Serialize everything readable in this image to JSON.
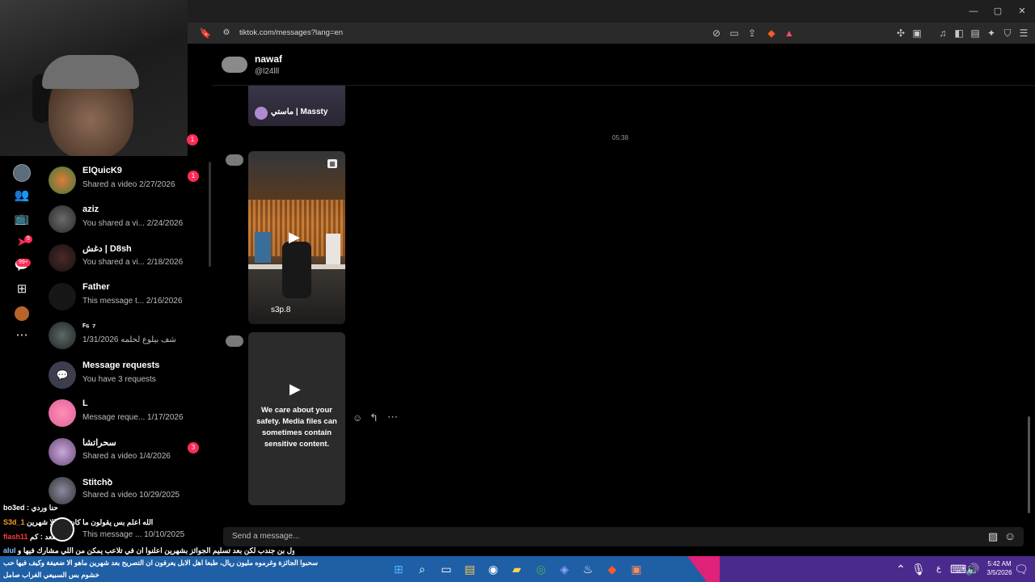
{
  "browser": {
    "url": "tiktok.com/messages?lang=en"
  },
  "rail": {
    "badge_activity": "5",
    "badge_inbox": "99+"
  },
  "conversations": [
    {
      "name": "ElQuicK9",
      "preview": "Shared a video",
      "date": "2/27/2026",
      "unread": "1"
    },
    {
      "name": "aziz",
      "preview": "You shared a vi...",
      "date": "2/24/2026",
      "unread": ""
    },
    {
      "name": "دغش | D8sh",
      "preview": "You shared a vi...",
      "date": "2/18/2026",
      "unread": ""
    },
    {
      "name": "Father",
      "preview": "This message t...",
      "date": "2/16/2026",
      "unread": ""
    },
    {
      "name": "ꟳ⁶ ⁷",
      "preview": "شف بيلوع لحلمه",
      "date": "1/31/2026",
      "unread": ""
    },
    {
      "name": "Message requests",
      "preview": "You have 3 requests",
      "date": "",
      "unread": ""
    },
    {
      "name": "L",
      "preview": "Message reque...",
      "date": "1/17/2026",
      "unread": ""
    },
    {
      "name": "سحراتشا",
      "preview": "Shared a video",
      "date": "1/4/2026",
      "unread": "3"
    },
    {
      "name": "Stitchꝺ",
      "preview": "Shared a video",
      "date": "10/29/2025",
      "unread": ""
    },
    {
      "name": "",
      "preview": "This message ...",
      "date": "10/10/2025",
      "unread": ""
    }
  ],
  "top_unread_badge": "1",
  "chat": {
    "name": "nawaf",
    "handle": "@l24lll",
    "timestamp": "05:38",
    "card1_label": "ماستي | Massty",
    "card2_label": "s3p.8",
    "safety_text": "We care about your safety. Media files can sometimes contain sensitive content.",
    "input_placeholder": "Send a message..."
  },
  "stream_chat": [
    {
      "user": "bo3ed",
      "text": "حنا وردي",
      "color": "#ffffff"
    },
    {
      "user": "S3d_1",
      "text": "الله اعلم بس يقولون ما كان فيه الا شهرين",
      "color": "#f0a030"
    },
    {
      "user": "flash11",
      "text": "مسعد : كم",
      "color": "#ff3b3b"
    },
    {
      "user": "",
      "text": "كان الاول بن جندب لكن بعد تسليم الجوائز بشهرين اعلنوا ان في تلاعب يمكن من اللي مشارك فيها و",
      "color": "#ffffff"
    },
    {
      "user": "alul",
      "text": "",
      "color": "#7fc8ff"
    }
  ],
  "ticker": [
    "سحبوا الجائزة وغرموه مليون ريال، طبعا اهل الابل يعرفون ان التصريح بعد شهرين ماهو الا ضعيفة وكيف فيها حب",
    "خشوم بس السبيعي الغراب صامل"
  ],
  "taskbar": {
    "time": "5:42 AM",
    "date": "3/5/2026",
    "lang": "ع"
  },
  "colors": {
    "accent": "#fe2c55",
    "taskbar": "#4a2a8c",
    "ticker": "#1f5fa6"
  }
}
